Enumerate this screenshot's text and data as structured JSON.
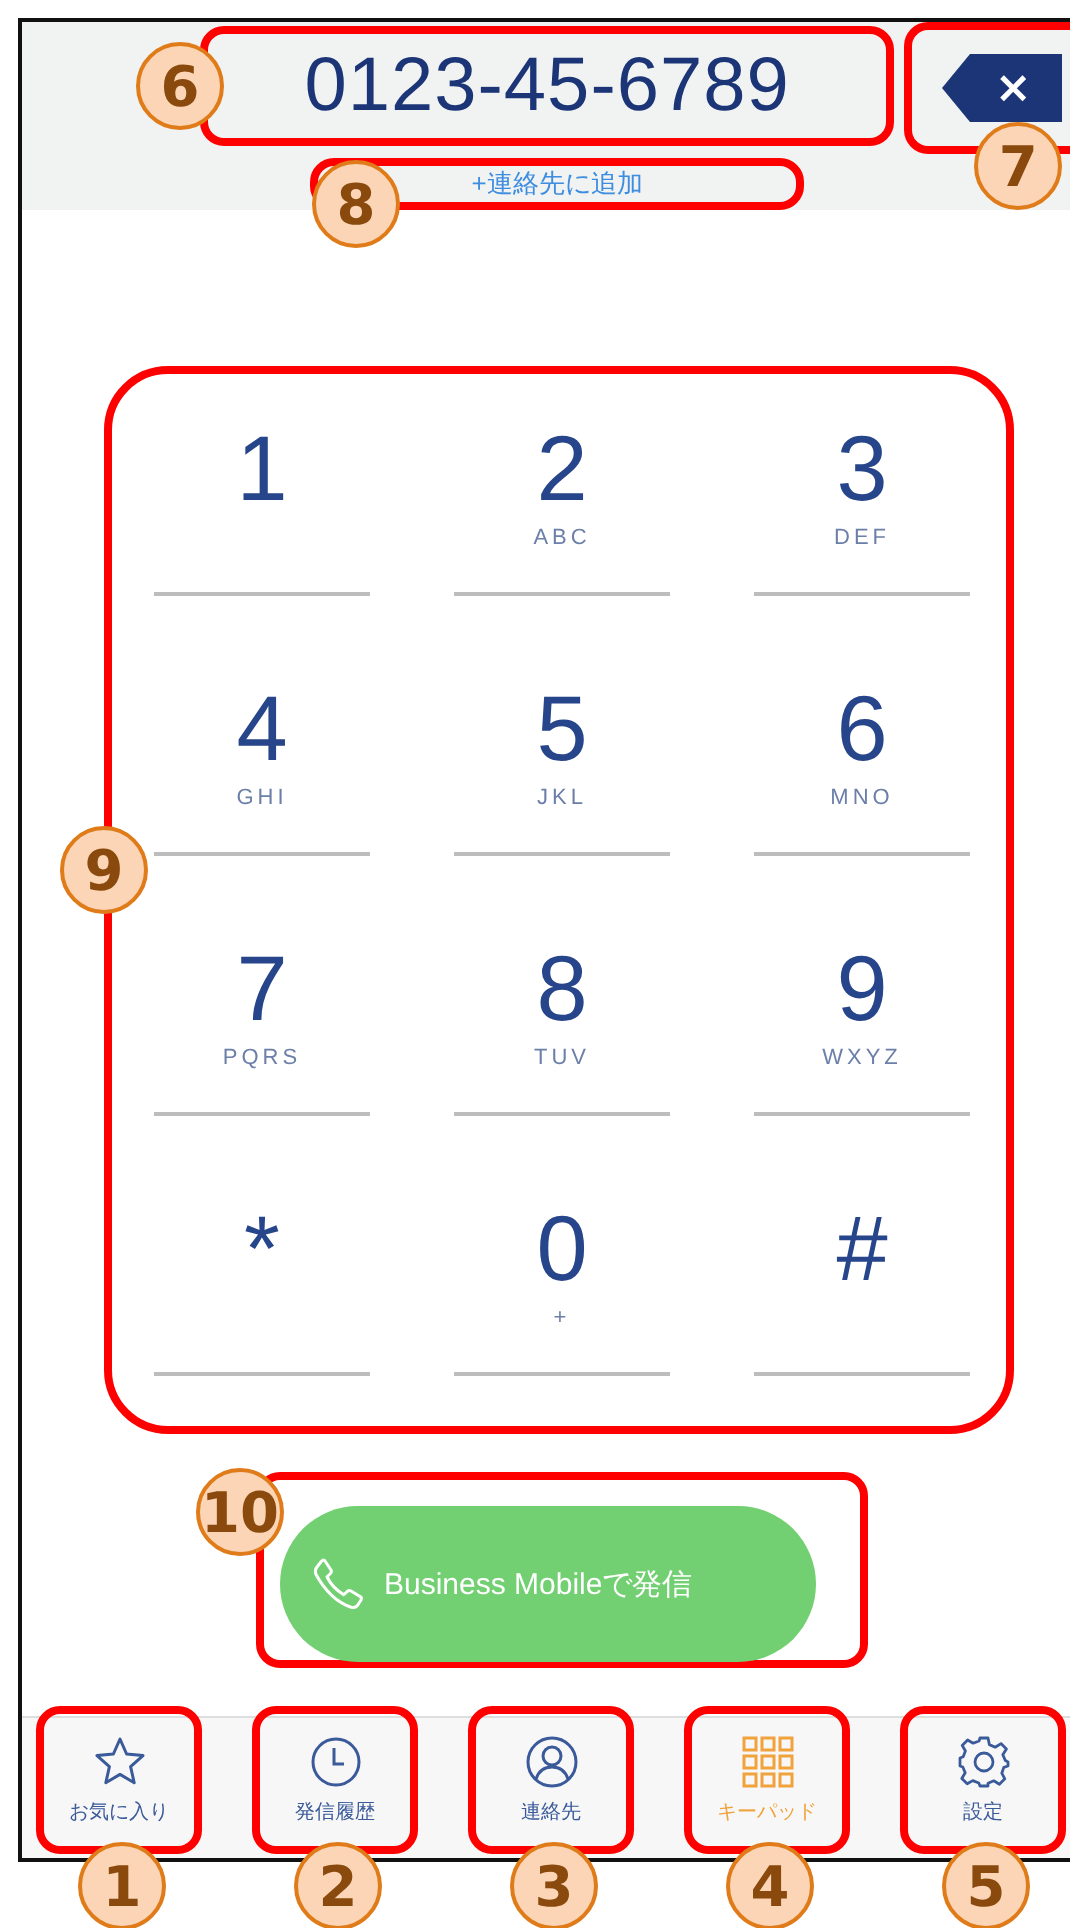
{
  "header": {
    "phone_number": "0123-45-6789",
    "number_callout": "6",
    "backspace": {
      "symbol": "×",
      "callout": "7"
    },
    "add_contact": {
      "label": "+連絡先に追加",
      "callout": "8"
    }
  },
  "keypad": {
    "callout": "9",
    "keys": [
      {
        "digit": "1"
      },
      {
        "digit": "2",
        "letters": "ABC"
      },
      {
        "digit": "3",
        "letters": "DEF"
      },
      {
        "digit": "4",
        "letters": "GHI"
      },
      {
        "digit": "5",
        "letters": "JKL"
      },
      {
        "digit": "6",
        "letters": "MNO"
      },
      {
        "digit": "7",
        "letters": "PQRS"
      },
      {
        "digit": "8",
        "letters": "TUV"
      },
      {
        "digit": "9",
        "letters": "WXYZ"
      },
      {
        "digit": "*"
      },
      {
        "digit": "0",
        "letters": "+"
      },
      {
        "digit": "#"
      }
    ]
  },
  "call_button": {
    "label": "Business Mobileで発信",
    "callout": "10"
  },
  "tabs": [
    {
      "kind": "favorites",
      "label": "お気に入り",
      "selected": false,
      "callout": "1"
    },
    {
      "kind": "history",
      "label": "発信履歴",
      "selected": false,
      "callout": "2"
    },
    {
      "kind": "contacts",
      "label": "連絡先",
      "selected": false,
      "callout": "3"
    },
    {
      "kind": "keypad",
      "label": "キーパッド",
      "selected": true,
      "callout": "4"
    },
    {
      "kind": "settings",
      "label": "設定",
      "selected": false,
      "callout": "5"
    }
  ]
}
